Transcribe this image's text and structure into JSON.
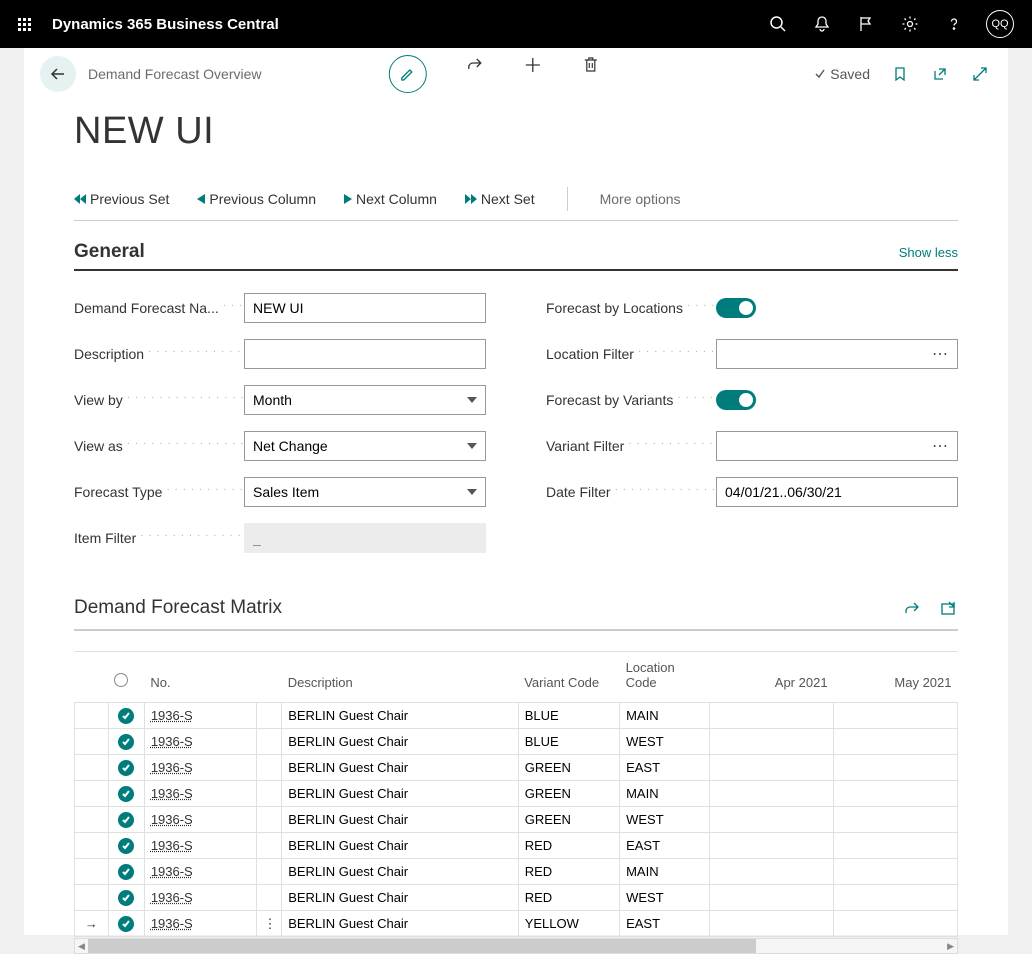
{
  "topbar": {
    "app_title": "Dynamics 365 Business Central",
    "avatar": "QQ"
  },
  "header": {
    "breadcrumb": "Demand Forecast Overview",
    "saved_label": "Saved"
  },
  "page_title": "NEW UI",
  "nav": {
    "prev_set": "Previous Set",
    "prev_col": "Previous Column",
    "next_col": "Next Column",
    "next_set": "Next Set",
    "more": "More options"
  },
  "general": {
    "title": "General",
    "show_less": "Show less",
    "labels": {
      "name": "Demand Forecast Na...",
      "description": "Description",
      "view_by": "View by",
      "view_as": "View as",
      "forecast_type": "Forecast Type",
      "item_filter": "Item Filter",
      "by_locations": "Forecast by Locations",
      "location_filter": "Location Filter",
      "by_variants": "Forecast by Variants",
      "variant_filter": "Variant Filter",
      "date_filter": "Date Filter"
    },
    "values": {
      "name": "NEW UI",
      "description": "",
      "view_by": "Month",
      "view_as": "Net Change",
      "forecast_type": "Sales Item",
      "item_filter": "_",
      "by_locations": true,
      "location_filter": "",
      "by_variants": true,
      "variant_filter": "",
      "date_filter": "04/01/21..06/30/21"
    }
  },
  "matrix": {
    "title": "Demand Forecast Matrix",
    "columns": {
      "no": "No.",
      "description": "Description",
      "variant": "Variant Code",
      "location": "Location Code",
      "m1": "Apr 2021",
      "m2": "May 2021"
    },
    "rows": [
      {
        "no": "1936-S",
        "desc": "BERLIN Guest Chair",
        "variant": "BLUE",
        "location": "MAIN"
      },
      {
        "no": "1936-S",
        "desc": "BERLIN Guest Chair",
        "variant": "BLUE",
        "location": "WEST"
      },
      {
        "no": "1936-S",
        "desc": "BERLIN Guest Chair",
        "variant": "GREEN",
        "location": "EAST"
      },
      {
        "no": "1936-S",
        "desc": "BERLIN Guest Chair",
        "variant": "GREEN",
        "location": "MAIN"
      },
      {
        "no": "1936-S",
        "desc": "BERLIN Guest Chair",
        "variant": "GREEN",
        "location": "WEST"
      },
      {
        "no": "1936-S",
        "desc": "BERLIN Guest Chair",
        "variant": "RED",
        "location": "EAST"
      },
      {
        "no": "1936-S",
        "desc": "BERLIN Guest Chair",
        "variant": "RED",
        "location": "MAIN"
      },
      {
        "no": "1936-S",
        "desc": "BERLIN Guest Chair",
        "variant": "RED",
        "location": "WEST"
      },
      {
        "no": "1936-S",
        "desc": "BERLIN Guest Chair",
        "variant": "YELLOW",
        "location": "EAST",
        "active": true
      }
    ]
  }
}
